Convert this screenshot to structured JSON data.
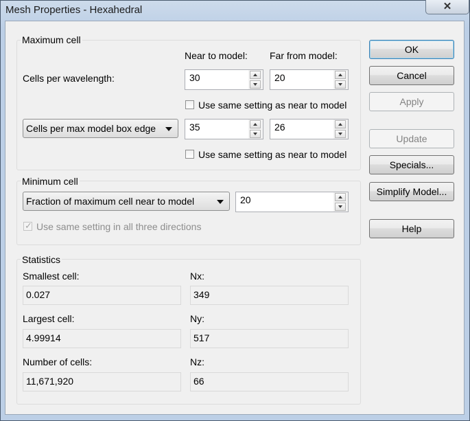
{
  "window": {
    "title": "Mesh Properties - Hexahedral",
    "close_glyph": "✕"
  },
  "maximum_cell": {
    "legend": "Maximum cell",
    "near_header": "Near to model:",
    "far_header": "Far from model:",
    "wavelength_label": "Cells per wavelength:",
    "wavelength_near": "30",
    "wavelength_far": "20",
    "same_setting_label_1": "Use same setting as near to model",
    "same_setting_1_checked": false,
    "box_edge_select": "Cells per max model box edge",
    "box_edge_near": "35",
    "box_edge_far": "26",
    "same_setting_label_2": "Use same setting as near to model",
    "same_setting_2_checked": false
  },
  "minimum_cell": {
    "legend": "Minimum cell",
    "select": "Fraction of maximum cell near to model",
    "value": "20",
    "same_directions_label": "Use same setting in all three directions",
    "same_directions_checked": true,
    "check_glyph": "✓"
  },
  "statistics": {
    "legend": "Statistics",
    "smallest_label": "Smallest cell:",
    "smallest_value": "0.027",
    "largest_label": "Largest cell:",
    "largest_value": "4.99914",
    "count_label": "Number of cells:",
    "count_value": "11,671,920",
    "nx_label": "Nx:",
    "nx_value": "349",
    "ny_label": "Ny:",
    "ny_value": "517",
    "nz_label": "Nz:",
    "nz_value": "66"
  },
  "buttons": {
    "ok": "OK",
    "cancel": "Cancel",
    "apply": "Apply",
    "update": "Update",
    "specials": "Specials...",
    "simplify": "Simplify Model...",
    "help": "Help"
  }
}
